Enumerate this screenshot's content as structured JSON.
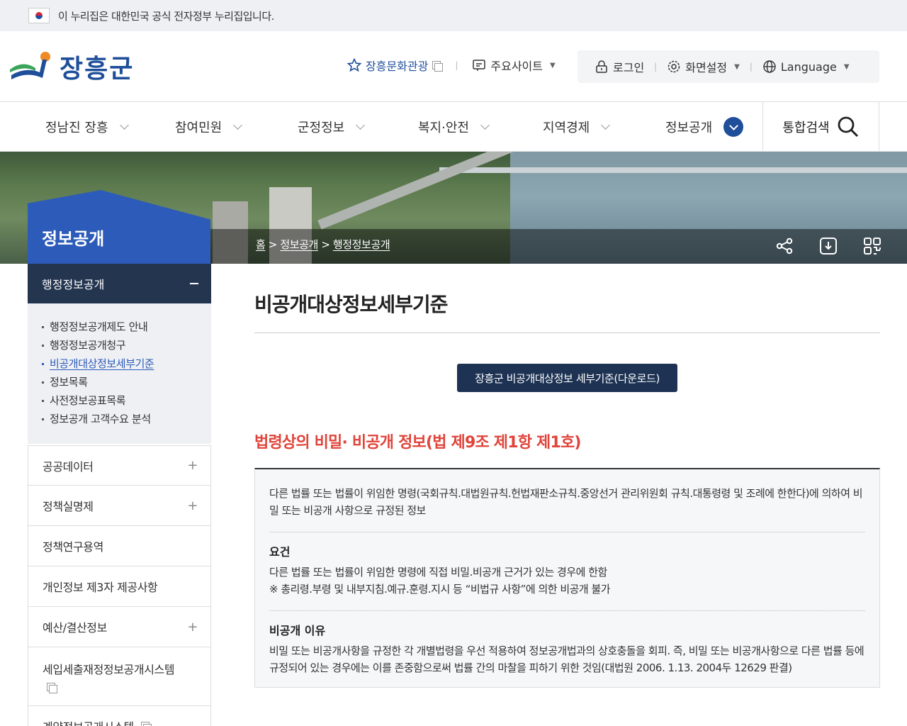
{
  "gov_banner": {
    "text": "이 누리집은 대한민국 공식 전자정부 누리집입니다."
  },
  "logo": {
    "text": "장흥군"
  },
  "util": {
    "culture": "장흥문화관광",
    "sites": "주요사이트",
    "login": "로그인",
    "screen": "화면설정",
    "language": "Language"
  },
  "gnb": {
    "items": [
      "정남진 장흥",
      "참여민원",
      "군정정보",
      "복지·안전",
      "지역경제",
      "정보공개"
    ],
    "search": "통합검색"
  },
  "side_title": "정보공개",
  "breadcrumb": {
    "home": "홈",
    "level1": "정보공개",
    "level2": "행정정보공개",
    "sep": ">"
  },
  "lnb": {
    "active": "행정정보공개",
    "sub": [
      "행정정보공개제도 안내",
      "행정정보공개청구",
      "비공개대상정보세부기준",
      "정보목록",
      "사전정보공표목록",
      "정보공개 고객수요 분석"
    ],
    "items": [
      "공공데이터",
      "정책실명제",
      "정책연구용역",
      "개인정보 제3자 제공사항",
      "예산/결산정보",
      "세입세출재정정보공개시스템",
      "계약정보공개시스템"
    ]
  },
  "content": {
    "title": "비공개대상정보세부기준",
    "download": "장흥군 비공개대상정보 세부기준(다운로드)",
    "section": "법령상의 비밀· 비공개 정보(법 제9조 제1항 제1호)",
    "desc": "다른 법률 또는 법률이 위임한 명령(국회규칙.대법원규칙.헌법재판소규칙.중앙선거 관리위원회 규칙.대통령령 및 조례에 한한다)에 의하여 비밀 또는 비공개 사항으로 규정된 정보",
    "req_title": "요건",
    "req_line1": "다른 법률 또는 법률이 위임한 명령에 직접 비밀.비공개 근거가 있는 경우에 한함",
    "req_line2": "※ 총리령.부령 및 내부지침.예규.훈령.지시 등 “비법규 사항”에 의한 비공개 불가",
    "reason_title": "비공개 이유",
    "reason_text": "비밀 또는 비공개사항을 규정한 각 개별법령을 우선 적용하여 정보공개법과의 상호충돌을 회피. 즉, 비밀 또는 비공개사항으로 다른 법률 등에 규정되어 있는 경우에는 이를 존중함으로써 법률 간의 마찰을 피하기 위한 것임(대법원 2006. 1.13. 2004두 12629 판결)"
  },
  "colors": {
    "primary": "#1f4e9a",
    "accent_red": "#e0443a",
    "navy": "#243550"
  }
}
